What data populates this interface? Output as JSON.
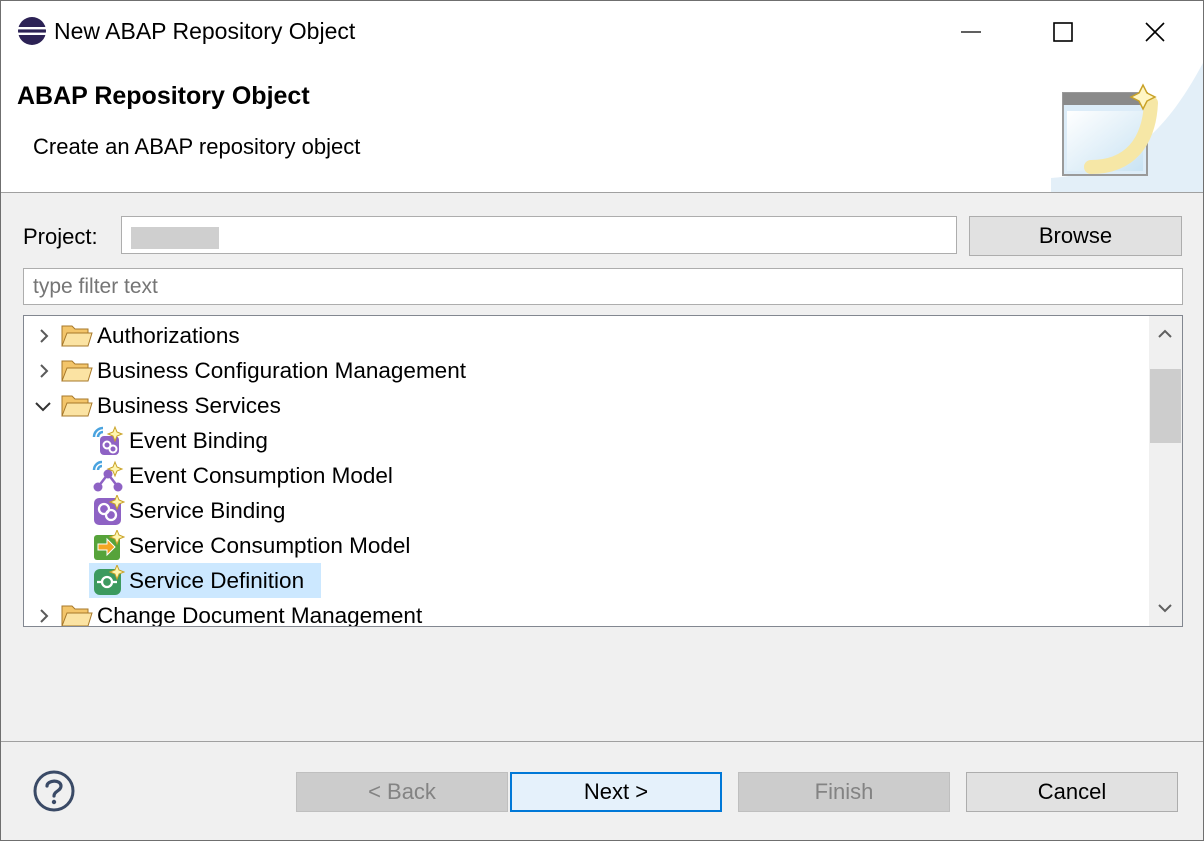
{
  "window": {
    "title": "New ABAP Repository Object",
    "app_icon": "eclipse-icon",
    "controls": [
      "minimize-icon",
      "maximize-icon",
      "close-icon"
    ]
  },
  "banner": {
    "title": "ABAP Repository Object",
    "description": "Create an ABAP repository object",
    "art": "wizard-banner-icon"
  },
  "project": {
    "label": "Project:",
    "value": "",
    "browse_label": "Browse"
  },
  "filter": {
    "placeholder": "type filter text",
    "value": ""
  },
  "tree": {
    "items": [
      {
        "label": "Authorizations",
        "type": "folder",
        "expanded": false,
        "level": 0
      },
      {
        "label": "Business Configuration Management",
        "type": "folder",
        "expanded": false,
        "level": 0
      },
      {
        "label": "Business Services",
        "type": "folder",
        "expanded": true,
        "level": 0
      },
      {
        "label": "Event Binding",
        "type": "object",
        "icon": "event-binding-icon",
        "level": 1
      },
      {
        "label": "Event Consumption Model",
        "type": "object",
        "icon": "event-consumption-model-icon",
        "level": 1
      },
      {
        "label": "Service Binding",
        "type": "object",
        "icon": "service-binding-icon",
        "level": 1
      },
      {
        "label": "Service Consumption Model",
        "type": "object",
        "icon": "service-consumption-model-icon",
        "level": 1
      },
      {
        "label": "Service Definition",
        "type": "object",
        "icon": "service-definition-icon",
        "level": 1,
        "selected": true
      },
      {
        "label": "Change Document Management",
        "type": "folder",
        "expanded": false,
        "level": 0
      }
    ]
  },
  "footer": {
    "help_icon": "help-icon",
    "back_label": "< Back",
    "next_label": "Next >",
    "finish_label": "Finish",
    "cancel_label": "Cancel"
  },
  "colors": {
    "selection": "#cce8ff",
    "default_button_border": "#0078d7",
    "disabled_text": "#838383"
  }
}
